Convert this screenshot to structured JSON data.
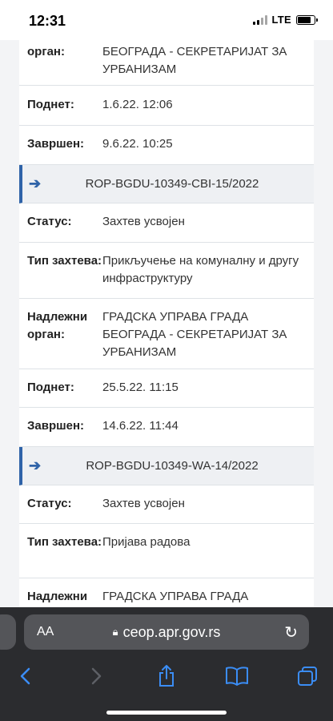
{
  "status_bar": {
    "time": "12:31",
    "network": "LTE"
  },
  "top_rows": [
    {
      "label": "орган:",
      "value": "БЕОГРАДА - СЕКРЕТАРИЈАТ ЗА УРБАНИЗАМ"
    },
    {
      "label": "Поднет:",
      "value": "1.6.22. 12:06"
    },
    {
      "label": "Завршен:",
      "value": "9.6.22. 10:25"
    }
  ],
  "case1": {
    "code": "ROP-BGDU-10349-CBI-15/2022",
    "status_label": "Статус:",
    "status_value": "Захтев усвојен",
    "type_label": "Тип захтева:",
    "type_value": "Прикључење на комуналну и другу инфраструктуру",
    "authority_label": "Надлежни орган:",
    "authority_value": "ГРАДСКА УПРАВА ГРАДА БЕОГРАДА - СЕКРЕТАРИЈАТ ЗА УРБАНИЗАМ",
    "submitted_label": "Поднет:",
    "submitted_value": "25.5.22. 11:15",
    "finished_label": "Завршен:",
    "finished_value": "14.6.22. 11:44"
  },
  "case2": {
    "code": "ROP-BGDU-10349-WA-14/2022",
    "status_label": "Статус:",
    "status_value": "Захтев усвојен",
    "type_label": "Тип захтева:",
    "type_value": "Пријава радова",
    "authority_label": "Надлежни",
    "authority_value": "ГРАДСКА УПРАВА ГРАДА"
  },
  "browser": {
    "aa_label": "AA",
    "url": "ceop.apr.gov.rs"
  },
  "icons": {
    "arrow": "right-arrow-icon",
    "lock": "lock-icon",
    "reload": "reload-icon",
    "back": "back-icon",
    "forward": "forward-icon",
    "share": "share-icon",
    "bookmarks": "bookmarks-icon",
    "tabs": "tabs-icon"
  },
  "colors": {
    "accent": "#2f63a8",
    "ios_blue": "#3b8df5",
    "toolbar": "#2b2c2f"
  }
}
